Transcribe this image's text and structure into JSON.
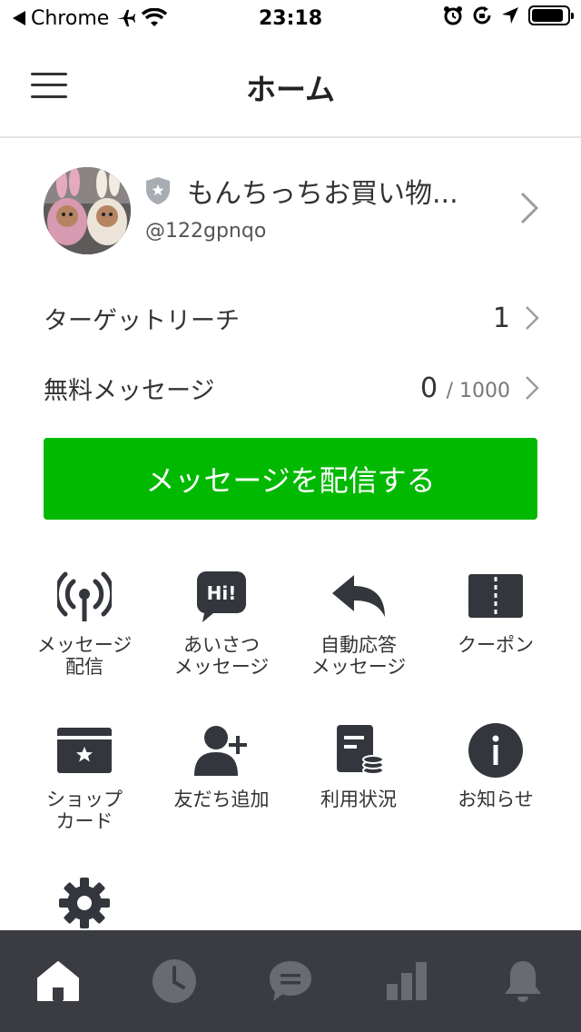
{
  "status_bar": {
    "back_app": "Chrome",
    "time": "23:18",
    "battery_level": 0.9
  },
  "header": {
    "title": "ホーム",
    "menu_icon": "hamburger-icon"
  },
  "account": {
    "name": "もんちっちお買い物...",
    "id": "@122gpnqo",
    "badge_icon": "shield-star-icon"
  },
  "stats": {
    "target_reach": {
      "label": "ターゲットリーチ",
      "value": "1"
    },
    "free_messages": {
      "label": "無料メッセージ",
      "value": "0",
      "limit": "/ 1000"
    }
  },
  "cta": {
    "label": "メッセージを配信する",
    "color": "#00b900"
  },
  "menu": [
    {
      "label": "メッセージ\n配信",
      "icon": "broadcast-icon"
    },
    {
      "label": "あいさつ\nメッセージ",
      "icon": "hi-bubble-icon"
    },
    {
      "label": "自動応答\nメッセージ",
      "icon": "reply-arrow-icon"
    },
    {
      "label": "クーポン",
      "icon": "coupon-icon"
    },
    {
      "label": "ショップ\nカード",
      "icon": "shop-card-icon"
    },
    {
      "label": "友だち追加",
      "icon": "add-friend-icon"
    },
    {
      "label": "利用状況",
      "icon": "usage-icon"
    },
    {
      "label": "お知らせ",
      "icon": "info-icon"
    },
    {
      "label": "",
      "icon": "gear-icon"
    }
  ],
  "bottom_nav": [
    {
      "icon": "home-icon",
      "active": true
    },
    {
      "icon": "clock-icon",
      "active": false
    },
    {
      "icon": "chat-icon",
      "active": false
    },
    {
      "icon": "chart-icon",
      "active": false
    },
    {
      "icon": "bell-icon",
      "active": false
    }
  ]
}
